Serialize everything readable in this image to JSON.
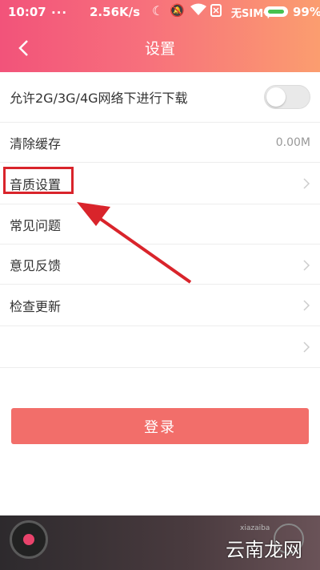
{
  "status_bar": {
    "time": "10:07",
    "dots": "...",
    "speed": "2.56K/s",
    "carrier": "无SIM卡",
    "battery": "99%"
  },
  "header": {
    "title": "设置",
    "back_icon": "chevron-left-icon"
  },
  "settings": {
    "items": [
      {
        "label": "允许2G/3G/4G网络下进行下载",
        "control": "toggle",
        "toggle_on": false
      },
      {
        "label": "清除缓存",
        "value": "0.00M"
      },
      {
        "label": "音质设置",
        "control": "chevron"
      },
      {
        "label": "常见问题"
      },
      {
        "label": "意见反馈",
        "control": "chevron"
      },
      {
        "label": "检查更新",
        "control": "chevron"
      },
      {
        "label": "",
        "control": "chevron"
      }
    ]
  },
  "login": {
    "label": "登录"
  },
  "watermark": {
    "text": "云南龙网",
    "url": "xiazaiba"
  },
  "colors": {
    "header_gradient_start": "#f2537a",
    "header_gradient_end": "#fb9d6f",
    "login_button": "#f26e6a",
    "annotation_red": "#d9242b"
  }
}
